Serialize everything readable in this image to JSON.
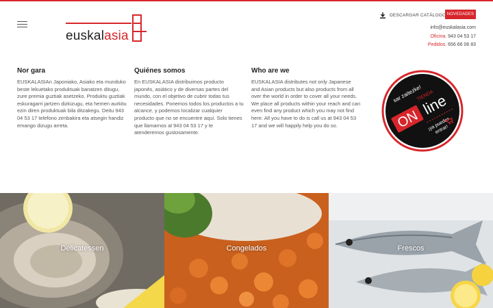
{
  "brand": {
    "logo_text_a": "euskal",
    "logo_text_b": "asia",
    "accent": "#d7262b"
  },
  "header": {
    "download_label": "DESCARGAR CATÁLOGO",
    "novedades_label": "NOVEDADES",
    "email": "info@euskalasia.com",
    "oficina_label": "Oficina.",
    "oficina_phone": "943 04 53 17",
    "pedidos_label": "Pedidos.",
    "pedidos_phone": "656 66 06 83"
  },
  "columns": [
    {
      "title": "Nor gara",
      "text": "EUSKALASIAn Japoniako, Asiako eta munduko beste lekuetako produktuak banatzen ditugu, zure premia guztiak asetzeko. Produktu guztiak eskuragarri jartzen dizkizugu, eta hemen aurkitu ezin diren produktuak bila ditzakegu. Deitu 943 04 53 17 telefono zenbakira eta atsegin handiz emango dizugu arreta."
    },
    {
      "title": "Quiénes somos",
      "text": "En EUSKALASIA distribuimos producto japonés, asiático y de diversas partes del mundo, con el objetivo de cubrir todas tus necesidades. Ponemos todos los productos a tu alcance, y podemos localizar cualquier producto que no se encuentre aquí. Solo tienes que llamarnos al 943 04 53 17 y te atenderemos gustosamente."
    },
    {
      "title": "Who are we",
      "text": "EUSKALASIA distributes not only Japanese and Asian products but also products from all over the world in order to cover all your needs. We place all products within your reach and can even find any product which you may not find here. All you have to do is call us at 943 04 53 17 and we will happily help you do so."
    }
  ],
  "badge": {
    "top_text": "sar zaitezke!",
    "tienda": "TIENDA",
    "on": "ON",
    "line": "line",
    "bottom_text_1": "¡ya puedes",
    "bottom_text_2": "entrar!"
  },
  "tiles": [
    {
      "label": "Delicatessen"
    },
    {
      "label": "Congelados"
    },
    {
      "label": "Frescos"
    }
  ]
}
